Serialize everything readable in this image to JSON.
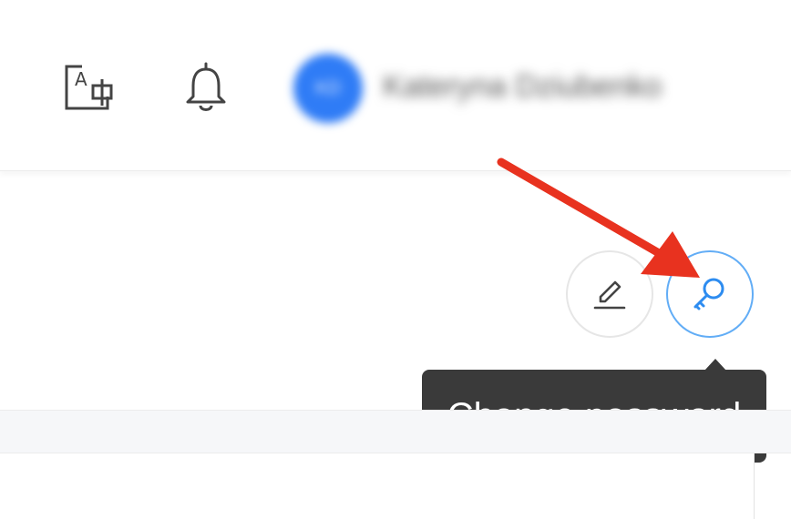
{
  "header": {
    "translate_icon": "translate-icon",
    "notifications_icon": "bell-icon",
    "user": {
      "avatar_initials": "KD",
      "name": "Kateryna Dziubenko"
    }
  },
  "actions": {
    "edit_icon": "pencil-icon",
    "change_password_icon": "key-icon",
    "tooltip": "Change password"
  },
  "colors": {
    "accent": "#62adf6",
    "avatar": "#2f7cf6",
    "tooltip_bg": "#3a3a3a",
    "annotation_arrow": "#e8321f"
  }
}
